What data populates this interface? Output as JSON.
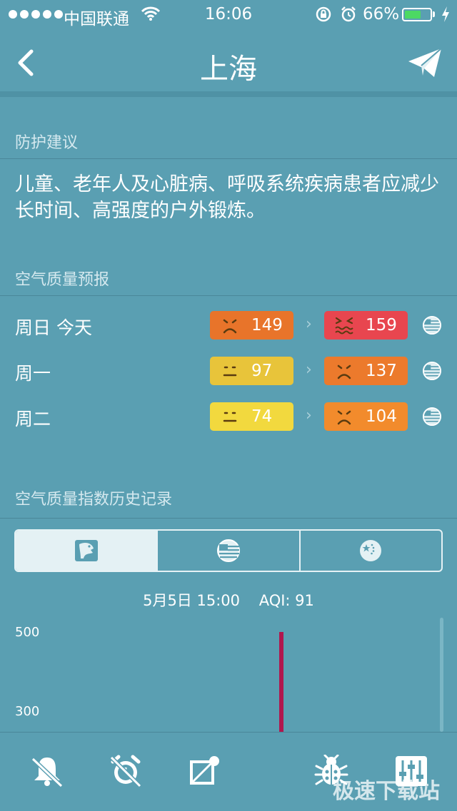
{
  "status_bar": {
    "carrier": "中国联通",
    "time": "16:06",
    "battery_percent_text": "66%",
    "battery_level": 0.66,
    "battery_color": "#4cd964"
  },
  "nav": {
    "title": "上海",
    "back_icon": "chevron-left-icon",
    "share_icon": "paper-plane-icon"
  },
  "advice": {
    "section_title": "防护建议",
    "text": "儿童、老年人及心脏病、呼吸系统疾病患者应减少长时间、高强度的户外锻炼。"
  },
  "forecast": {
    "section_title": "空气质量预报",
    "rows": [
      {
        "day": "周日 今天",
        "low": "149",
        "low_color": "#e8742a",
        "low_face": "frown",
        "high": "159",
        "high_color": "#e8464f",
        "high_face": "grimace"
      },
      {
        "day": "周一",
        "low": "97",
        "low_color": "#e8c43a",
        "low_face": "neutral",
        "high": "137",
        "high_color": "#ec7a2c",
        "high_face": "frown"
      },
      {
        "day": "周二",
        "low": "74",
        "low_color": "#f2d93e",
        "low_face": "neutral",
        "high": "104",
        "high_color": "#f28b2c",
        "high_face": "frown"
      }
    ]
  },
  "history": {
    "section_title": "空气质量指数历史记录",
    "tabs": [
      "eagle-icon",
      "us-flag-icon",
      "china-flag-icon"
    ],
    "readout_time": "5月5日 15:00",
    "readout_aqi": "AQI: 91",
    "tick_500": "500",
    "tick_300": "300"
  },
  "toolbar": {
    "icons": [
      "bell-off-icon",
      "alarm-off-icon",
      "notification-off-icon",
      "bug-icon",
      "sliders-icon"
    ]
  },
  "watermark": "极速下载站"
}
